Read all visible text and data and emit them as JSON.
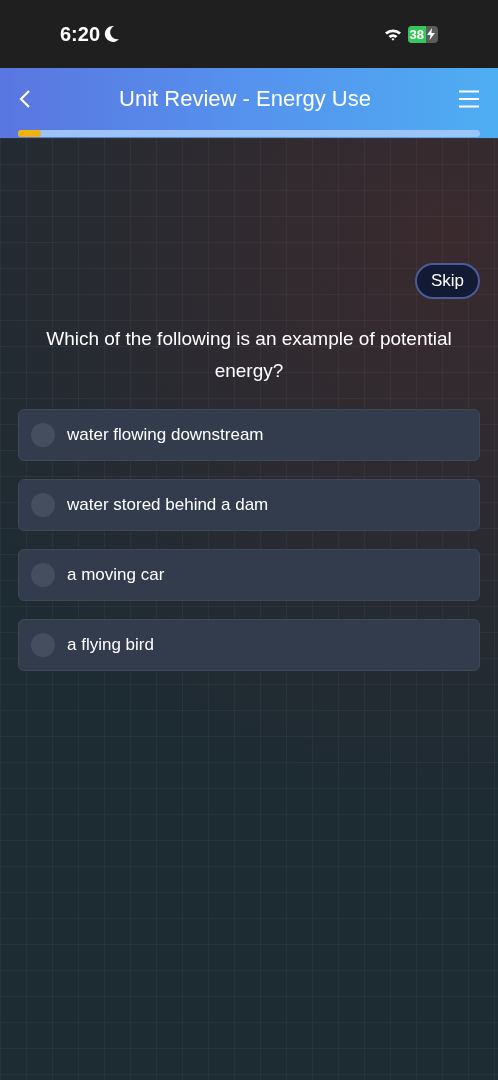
{
  "status_bar": {
    "time": "6:20",
    "battery": "38"
  },
  "header": {
    "title": "Unit Review - Energy Use",
    "progress": {
      "level": 0.05
    }
  },
  "skip_button": "Skip",
  "question": "Which of the following is an example of potential energy?",
  "options": [
    {
      "label": "water flowing downstream",
      "selected": false
    },
    {
      "label": "water stored behind a dam",
      "selected": false
    },
    {
      "label": "a moving car",
      "selected": false
    },
    {
      "label": "a flying bird",
      "selected": false
    }
  ]
}
